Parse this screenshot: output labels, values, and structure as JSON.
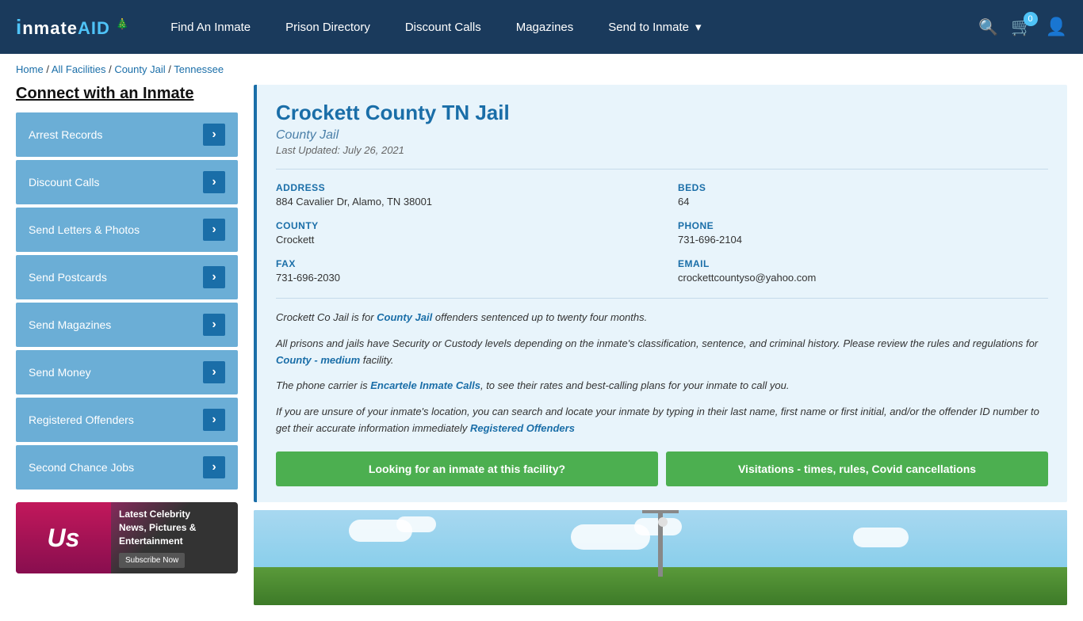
{
  "header": {
    "logo_text": "inmate",
    "logo_aid": "AID",
    "nav_items": [
      {
        "label": "Find An Inmate",
        "id": "find-inmate"
      },
      {
        "label": "Prison Directory",
        "id": "prison-directory"
      },
      {
        "label": "Discount Calls",
        "id": "discount-calls"
      },
      {
        "label": "Magazines",
        "id": "magazines"
      },
      {
        "label": "Send to Inmate",
        "id": "send-to-inmate",
        "dropdown": true
      }
    ],
    "cart_count": "0"
  },
  "breadcrumb": {
    "items": [
      "Home",
      "All Facilities",
      "County Jail",
      "Tennessee"
    ],
    "separator": "/"
  },
  "sidebar": {
    "title": "Connect with an Inmate",
    "menu_items": [
      {
        "label": "Arrest Records",
        "id": "arrest-records"
      },
      {
        "label": "Discount Calls",
        "id": "discount-calls"
      },
      {
        "label": "Send Letters & Photos",
        "id": "send-letters"
      },
      {
        "label": "Send Postcards",
        "id": "send-postcards"
      },
      {
        "label": "Send Magazines",
        "id": "send-magazines"
      },
      {
        "label": "Send Money",
        "id": "send-money"
      },
      {
        "label": "Registered Offenders",
        "id": "registered-offenders"
      },
      {
        "label": "Second Chance Jobs",
        "id": "second-chance-jobs"
      }
    ]
  },
  "ad": {
    "brand": "Us",
    "line1": "Latest Celebrity",
    "line2": "News, Pictures &",
    "line3": "Entertainment",
    "button_label": "Subscribe Now"
  },
  "facility": {
    "title": "Crockett County TN Jail",
    "subtitle": "County Jail",
    "last_updated": "Last Updated: July 26, 2021",
    "address_label": "ADDRESS",
    "address_value": "884 Cavalier Dr, Alamo, TN 38001",
    "beds_label": "BEDS",
    "beds_value": "64",
    "county_label": "COUNTY",
    "county_value": "Crockett",
    "phone_label": "PHONE",
    "phone_value": "731-696-2104",
    "fax_label": "FAX",
    "fax_value": "731-696-2030",
    "email_label": "EMAIL",
    "email_value": "crockettcountyso@yahoo.com",
    "desc1": "Crockett Co Jail is for County Jail offenders sentenced up to twenty four months.",
    "desc1_link_text": "County Jail",
    "desc1_link_before": "Crockett Co Jail is for ",
    "desc1_link_after": " offenders sentenced up to twenty four months.",
    "desc2_before": "All prisons and jails have Security or Custody levels depending on the inmate's classification, sentence, and criminal history. Please review the rules and regulations for ",
    "desc2_link_text": "County - medium",
    "desc2_after": " facility.",
    "desc3_before": "The phone carrier is ",
    "desc3_link_text": "Encartele Inmate Calls",
    "desc3_after": ", to see their rates and best-calling plans for your inmate to call you.",
    "desc4_before": "If you are unsure of your inmate's location, you can search and locate your inmate by typing in their last name, first name or first initial, and/or the offender ID number to get their accurate information immediately ",
    "desc4_link_text": "Registered Offenders",
    "desc4_after": "",
    "btn1_label": "Looking for an inmate at this facility?",
    "btn2_label": "Visitations - times, rules, Covid cancellations"
  }
}
